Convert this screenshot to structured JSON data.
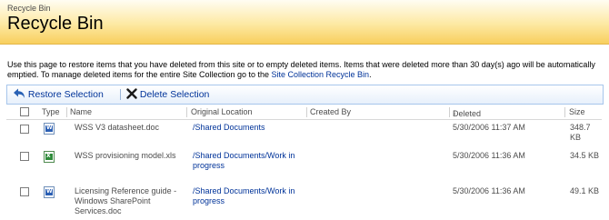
{
  "header": {
    "breadcrumb": "Recycle Bin",
    "title": "Recycle Bin"
  },
  "description": {
    "text": "Use this page to restore items that you have deleted from this site or to empty deleted items. Items that were deleted more than 30 day(s) ago will be automatically emptied. To manage deleted items for the entire Site Collection go to the ",
    "link": "Site Collection Recycle Bin",
    "suffix": "."
  },
  "toolbar": {
    "restore_label": "Restore Selection",
    "delete_label": "Delete Selection"
  },
  "columns": {
    "type": "Type",
    "name": "Name",
    "location": "Original Location",
    "created_by": "Created By",
    "deleted": "Deleted",
    "size": "Size"
  },
  "rows": [
    {
      "icon": "word-doc-icon",
      "name": "WSS V3 datasheet.doc",
      "location": "/Shared Documents",
      "created_by": "",
      "deleted": "5/30/2006 11:37 AM",
      "size": "348.7 KB"
    },
    {
      "icon": "excel-xls-icon",
      "name": "WSS provisioning model.xls",
      "location": "/Shared Documents/Work in progress",
      "created_by": "",
      "deleted": "5/30/2006 11:36 AM",
      "size": "34.5 KB"
    },
    {
      "icon": "word-doc-icon",
      "name": "Licensing Reference guide - Windows SharePoint Services.doc",
      "location": "/Shared Documents/Work in progress",
      "created_by": "",
      "deleted": "5/30/2006 11:36 AM",
      "size": "49.1 KB"
    }
  ],
  "colors": {
    "link": "#003399",
    "header_gradient_end": "#f8cf5e",
    "toolbar_border": "#a7c6ec"
  }
}
